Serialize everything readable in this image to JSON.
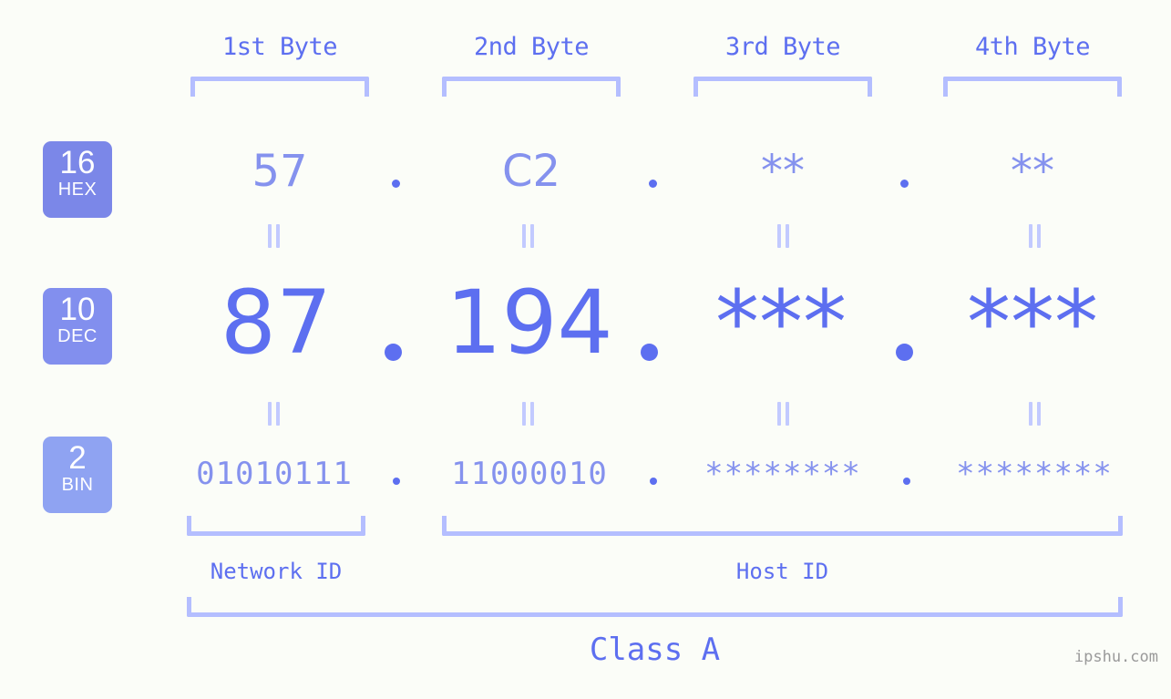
{
  "background_color": "#fbfdf8",
  "accent_color": "#5d6ff0",
  "accent_light": "#8592ee",
  "bracket_color": "#b4beff",
  "equals_color": "#c2caff",
  "byte_headers": [
    {
      "label": "1st Byte"
    },
    {
      "label": "2nd Byte"
    },
    {
      "label": "3rd Byte"
    },
    {
      "label": "4th Byte"
    }
  ],
  "bases": [
    {
      "number": "16",
      "name": "HEX",
      "color": "#7b87e8"
    },
    {
      "number": "10",
      "name": "DEC",
      "color": "#828fee"
    },
    {
      "number": "2",
      "name": "BIN",
      "color": "#8fa3f2"
    }
  ],
  "rows": {
    "hex": {
      "values": [
        "57",
        "C2",
        "**",
        "**"
      ],
      "separator": "."
    },
    "dec": {
      "values": [
        "87",
        "194",
        "***",
        "***"
      ],
      "separator": "."
    },
    "bin": {
      "values": [
        "01010111",
        "11000010",
        "********",
        "********"
      ],
      "separator": "."
    }
  },
  "sections": {
    "network_id": "Network ID",
    "host_id": "Host ID",
    "class": "Class A"
  },
  "watermark": "ipshu.com"
}
